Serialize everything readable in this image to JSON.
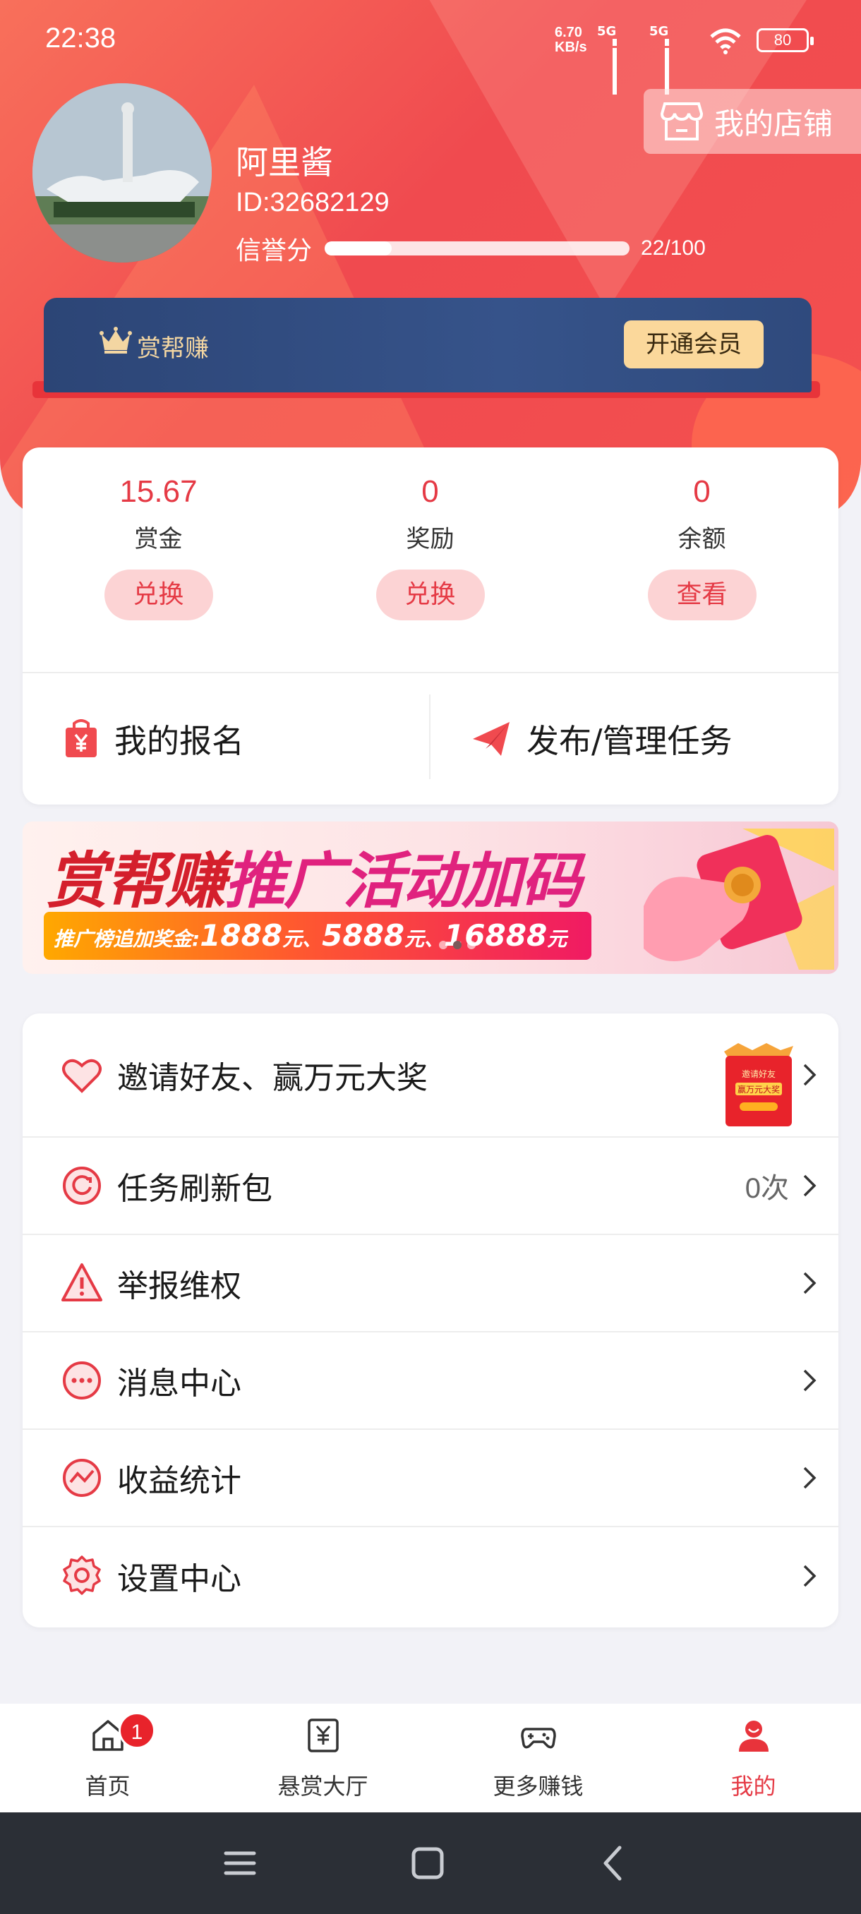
{
  "status_bar": {
    "time": "22:38",
    "net_speed_value": "6.70",
    "net_speed_unit": "KB/s",
    "sim1": "5G",
    "sim2": "5G",
    "battery": "80"
  },
  "profile": {
    "username": "阿里酱",
    "user_id": "ID:32682129",
    "credit_label": "信誉分",
    "credit_value": "22/100",
    "credit_fraction": 0.22,
    "shop_button": "我的店铺"
  },
  "vip": {
    "brand": "赏帮赚",
    "open_button": "开通会员"
  },
  "wallet": {
    "items": [
      {
        "value": "15.67",
        "label": "赏金",
        "action": "兑换"
      },
      {
        "value": "0",
        "label": "奖励",
        "action": "兑换"
      },
      {
        "value": "0",
        "label": "余额",
        "action": "查看"
      }
    ],
    "links": [
      {
        "label": "我的报名",
        "icon": "shopping-bag-yen-icon"
      },
      {
        "label": "发布/管理任务",
        "icon": "paper-plane-icon"
      }
    ]
  },
  "banner": {
    "title_part1": "赏帮赚",
    "title_part2": "推广活动加码",
    "strip_prefix": "推广榜追加奖金:",
    "amount1": "1888",
    "unit1": "元、",
    "amount2": "5888",
    "unit2": "元、",
    "amount3": "16888",
    "unit3": "元"
  },
  "menu": {
    "items": [
      {
        "label": "邀请好友、赢万元大奖",
        "icon": "heart-icon",
        "extra": ""
      },
      {
        "label": "任务刷新包",
        "icon": "refresh-icon",
        "extra": "0次"
      },
      {
        "label": "举报维权",
        "icon": "warning-icon",
        "extra": ""
      },
      {
        "label": "消息中心",
        "icon": "message-icon",
        "extra": ""
      },
      {
        "label": "收益统计",
        "icon": "chart-icon",
        "extra": ""
      },
      {
        "label": "设置中心",
        "icon": "settings-icon",
        "extra": ""
      }
    ]
  },
  "tabbar": {
    "items": [
      {
        "label": "首页",
        "icon": "home-icon",
        "badge": "1"
      },
      {
        "label": "悬赏大厅",
        "icon": "reward-hall-icon"
      },
      {
        "label": "更多赚钱",
        "icon": "gamepad-icon"
      },
      {
        "label": "我的",
        "icon": "user-icon",
        "active": true
      }
    ]
  },
  "colors": {
    "accent": "#e53a45",
    "header_red": "#f04a4f",
    "vip_blue": "#2f4a7d",
    "vip_gold": "#fbd89b"
  }
}
